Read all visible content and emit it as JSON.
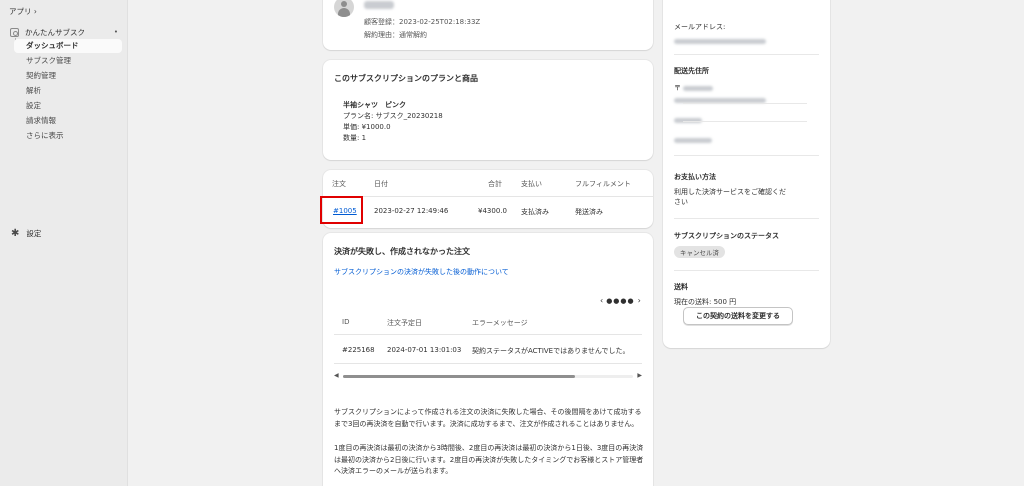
{
  "nav": {
    "apps_label": "アプリ ›",
    "app_name": "かんたんサブスク",
    "app_dot": "•",
    "active_item": "ダッシュボード",
    "items": [
      "サブスク管理",
      "契約管理",
      "解析",
      "設定",
      "請求情報",
      "さらに表示"
    ],
    "settings_label": "設定"
  },
  "customer": {
    "registered": "顧客登録：2023-02-25T02:18:33Z",
    "cancel_reason": "解約理由：通常解約"
  },
  "plan": {
    "title": "このサブスクリプションのプランと商品",
    "product_name": "半袖シャツ　ピンク",
    "plan_name": "プラン名: サブスク_20230218",
    "unit_price": "単価: ¥1000.0",
    "quantity": "数量: 1"
  },
  "orders": {
    "headers": {
      "order": "注文",
      "date": "日付",
      "total": "合計",
      "payment": "支払い",
      "fulfillment": "フルフィルメント"
    },
    "rows": [
      {
        "order": "#1005",
        "date": "2023-02-27 12:49:46",
        "total": "¥4300.0",
        "payment": "支払済み",
        "fulfillment": "発送済み"
      }
    ]
  },
  "failed": {
    "title": "決済が失敗し、作成されなかった注文",
    "link": "サブスクリプションの決済が失敗した後の動作について",
    "pager_dots": "●●●●",
    "headers": {
      "id": "ID",
      "date": "注文予定日",
      "error": "エラーメッセージ"
    },
    "rows": [
      {
        "id": "#225168",
        "date": "2024-07-01 13:01:03",
        "error": "契約ステータスがACTIVEではありませんでした。"
      }
    ],
    "para1": "サブスクリプションによって作成される注文の決済に失敗した場合、その後間隔をあけて成功するまで3回の再決済を自動で行います。決済に成功するまで、注文が作成されることはありません。",
    "para2": "1度目の再決済は最初の決済から3時間後、2度目の再決済は最初の決済から1日後、3度目の再決済は最初の決済から2日後に行います。2度目の再決済が失敗したタイミングでお客様とストア管理者へ決済エラーのメールが送られます。"
  },
  "info": {
    "email_label": "メールアドレス:",
    "shipping_title": "配送先住所",
    "shipping_zip_prefix": "〒",
    "payment_title": "お支払い方法",
    "payment_text": "利用した決済サービスをご確認ください",
    "status_title": "サブスクリプションのステータス",
    "status_badge": "キャンセル済",
    "shipping_fee_title": "送料",
    "shipping_fee_current": "現在の送料: 500 円",
    "change_fee_button": "この契約の送料を変更する"
  },
  "colors": {
    "link": "#005bd3",
    "highlight": "#e00000",
    "sidebar_bg": "#ebebeb",
    "page_bg": "#f1f1f1"
  }
}
